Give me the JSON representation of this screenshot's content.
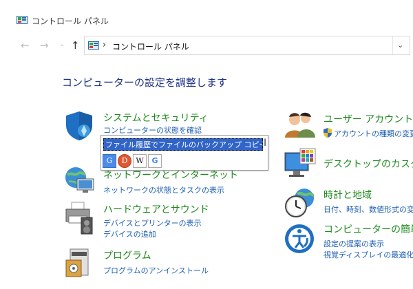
{
  "window": {
    "title": "コントロール パネル"
  },
  "nav": {
    "back": "←",
    "forward": "→",
    "recent": "⌄",
    "up": "↑",
    "address_sep": "›",
    "address_crumb": "コントロール パネル",
    "address_dropdown": "⌄"
  },
  "heading": "コンピューターの設定を調整します",
  "categories_left": [
    {
      "icon": "shield-icon",
      "title": "システムとセキュリティ",
      "links": [
        "コンピューターの状態を確認"
      ]
    },
    {
      "icon": "network-globe-icon",
      "title": "ネットワークとインターネット",
      "links": [
        "ネットワークの状態とタスクの表示"
      ]
    },
    {
      "icon": "printer-icon",
      "title": "ハードウェアとサウンド",
      "links": [
        "デバイスとプリンターの表示",
        "デバイスの追加"
      ]
    },
    {
      "icon": "programs-icon",
      "title": "プログラム",
      "links": [
        "プログラムのアンインストール"
      ]
    }
  ],
  "categories_right": [
    {
      "icon": "users-icon",
      "title": "ユーザー アカウント",
      "links": [
        "アカウントの種類の変更"
      ]
    },
    {
      "icon": "desktop-icon",
      "title": "デスクトップのカスタマ",
      "links": []
    },
    {
      "icon": "clock-globe-icon",
      "title": "時計と地域",
      "links": [
        "日付、時刻、数値形式の変"
      ]
    },
    {
      "icon": "accessibility-icon",
      "title": "コンピューターの簡単操",
      "links": [
        "設定の提案の表示",
        "視覚ディスプレイの最適化"
      ]
    }
  ],
  "popup": {
    "selected_text": "ファイル履歴でファイルのバックアップ コピーを保存",
    "engines": [
      {
        "icon": "google-translate-icon",
        "label": "G"
      },
      {
        "icon": "duckduckgo-icon",
        "label": "D"
      },
      {
        "icon": "wikipedia-icon",
        "label": "W"
      },
      {
        "icon": "google-icon",
        "label": "G"
      }
    ]
  },
  "colors": {
    "heading": "#1e3287",
    "category_title": "#1e8a1e",
    "link": "#1e5fb4",
    "selection": "#3064c8"
  }
}
